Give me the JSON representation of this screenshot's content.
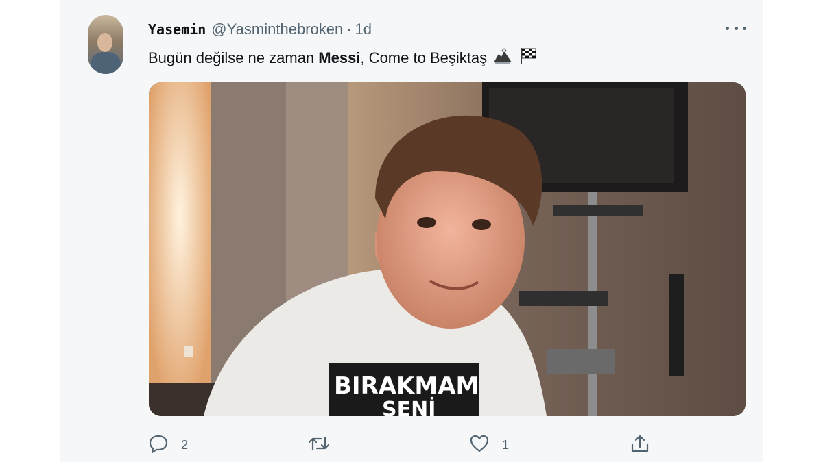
{
  "tweet": {
    "display_name": "Yasemin",
    "handle": "@Yasminthebroken",
    "separator": "·",
    "time": "1d",
    "text_before": "Bugün değilse ne zaman ",
    "text_bold": "Messi",
    "text_after": ", Come to Beşiktaş",
    "emojis": [
      "eagle-icon",
      "checkered-flag-icon"
    ],
    "media": {
      "shirt_text": "BIRAKMAM",
      "shirt_text_2": "SENİ"
    }
  },
  "actions": {
    "reply_count": "2",
    "retweet_count": "",
    "like_count": "1",
    "icons": [
      "reply-icon",
      "retweet-icon",
      "like-icon",
      "share-icon"
    ]
  },
  "colors": {
    "background": "#f6f7f8",
    "secondary_text": "#536471",
    "primary_text": "#0f1419"
  }
}
